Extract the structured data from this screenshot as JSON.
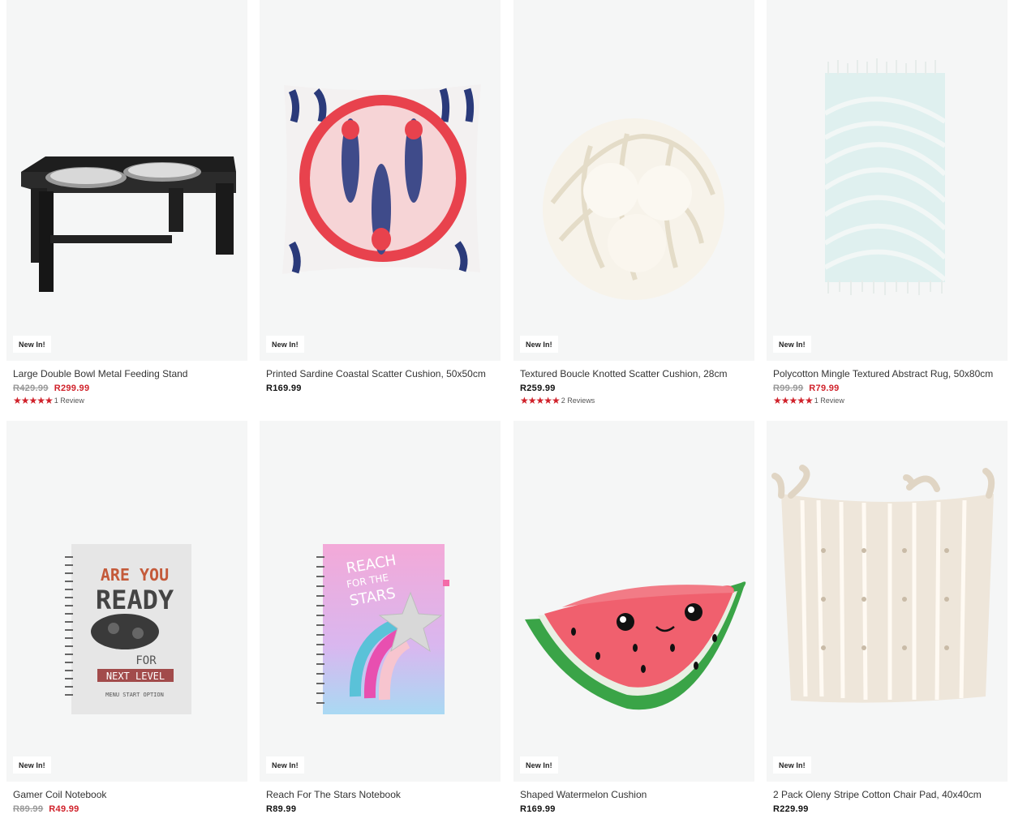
{
  "products": [
    {
      "badge": "New In!",
      "title": "Large Double Bowl Metal Feeding Stand",
      "was_price": "R429.99",
      "price": "R299.99",
      "stars": "★★★★★",
      "reviews": "1 Review",
      "icon": "pet-bowl-stand"
    },
    {
      "badge": "New In!",
      "title": "Printed Sardine Coastal Scatter Cushion, 50x50cm",
      "price": "R169.99",
      "icon": "sardine-cushion"
    },
    {
      "badge": "New In!",
      "title": "Textured Boucle Knotted Scatter Cushion, 28cm",
      "price": "R259.99",
      "stars": "★★★★★",
      "reviews": "2 Reviews",
      "icon": "knot-cushion"
    },
    {
      "badge": "New In!",
      "title": "Polycotton Mingle Textured Abstract Rug, 50x80cm",
      "was_price": "R99.99",
      "price": "R79.99",
      "stars": "★★★★★",
      "reviews": "1 Review",
      "icon": "rug"
    },
    {
      "badge": "New In!",
      "title": "Gamer Coil Notebook",
      "was_price": "R89.99",
      "price": "R49.99",
      "icon": "gamer-notebook"
    },
    {
      "badge": "New In!",
      "title": "Reach For The Stars Notebook",
      "price": "R89.99",
      "icon": "stars-notebook"
    },
    {
      "badge": "New In!",
      "title": "Shaped Watermelon Cushion",
      "price": "R169.99",
      "icon": "watermelon-cushion"
    },
    {
      "badge": "New In!",
      "title": "2 Pack Oleny Stripe Cotton Chair Pad, 40x40cm",
      "price": "R229.99",
      "icon": "chair-pad"
    }
  ],
  "artwork": {
    "gamer_line1": "ARE YOU",
    "gamer_line2": "READY",
    "gamer_line3": "FOR",
    "gamer_line4": "NEXT LEVEL",
    "gamer_line5": "MENU START OPTION",
    "stars_line1": "REACH",
    "stars_line2": "FOR THE",
    "stars_line3": "STARS"
  },
  "colors": {
    "sale": "#d0212a",
    "star": "#d0212a",
    "tile_bg": "#f5f6f6"
  }
}
